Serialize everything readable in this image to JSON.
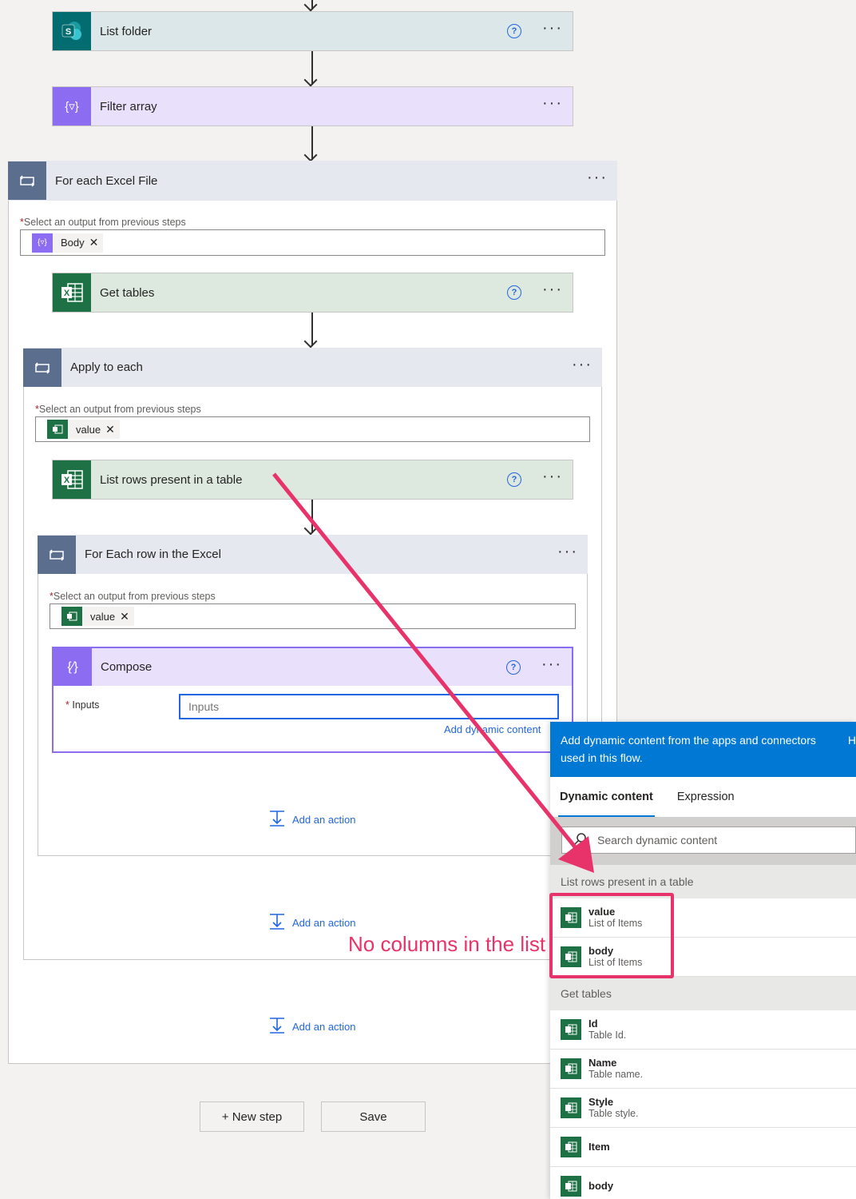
{
  "flow": {
    "list_folder": {
      "title": "List folder"
    },
    "filter_array": {
      "title": "Filter array"
    },
    "foreach_excel": {
      "title": "For each Excel File",
      "select_label": "Select an output from previous steps",
      "token": "Body"
    },
    "get_tables": {
      "title": "Get tables"
    },
    "apply_to_each": {
      "title": "Apply to each",
      "select_label": "Select an output from previous steps",
      "token": "value"
    },
    "list_rows": {
      "title": "List rows present in a table"
    },
    "foreach_row": {
      "title": "For Each row in the Excel",
      "select_label": "Select an output from previous steps",
      "token": "value"
    },
    "compose": {
      "title": "Compose",
      "inputs_label": "Inputs",
      "inputs_placeholder": "Inputs",
      "add_dynamic_link": "Add dynamic content"
    },
    "add_action_label": "Add an action",
    "new_step_label": "+ New step",
    "save_label": "Save"
  },
  "dynamic_panel": {
    "header_text": "Add dynamic content from the apps and connectors used in this flow.",
    "header_hide": "H",
    "tabs": [
      "Dynamic content",
      "Expression"
    ],
    "search_placeholder": "Search dynamic content",
    "sections": [
      {
        "title": "List rows present in a table",
        "items": [
          {
            "name": "value",
            "desc": "List of Items"
          },
          {
            "name": "body",
            "desc": "List of Items"
          }
        ]
      },
      {
        "title": "Get tables",
        "items": [
          {
            "name": "Id",
            "desc": "Table Id."
          },
          {
            "name": "Name",
            "desc": "Table name."
          },
          {
            "name": "Style",
            "desc": "Table style."
          },
          {
            "name": "Item",
            "desc": ""
          },
          {
            "name": "body",
            "desc": ""
          }
        ]
      }
    ]
  },
  "annotation": {
    "text": "No columns in the list",
    "color": "#e8336a"
  },
  "colors": {
    "accent": "#0078d4",
    "link": "#2266e3",
    "excel": "#1e7145",
    "sharepoint": "#036c70",
    "data_op": "#8c6cf0",
    "loop": "#5b6e8d"
  }
}
